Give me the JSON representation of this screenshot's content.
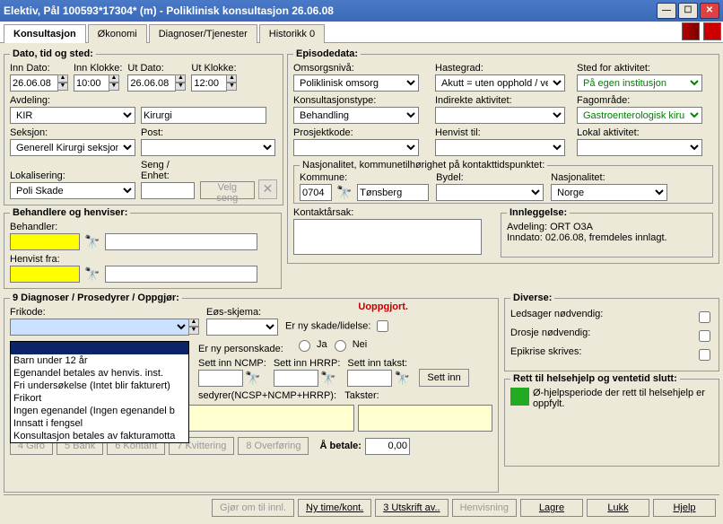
{
  "window": {
    "title": "Elektiv, Pål 100593*17304* (m) - Poliklinisk konsultasjon 26.06.08"
  },
  "tabs": [
    "Konsultasjon",
    "Økonomi",
    "Diagnoser/Tjenester",
    "Historikk 0"
  ],
  "dts": {
    "legend": "Dato, tid og sted:",
    "inn_dato_lbl": "Inn Dato:",
    "inn_dato": "26.06.08",
    "inn_klokke_lbl": "Inn Klokke:",
    "inn_klokke": "10:00",
    "ut_dato_lbl": "Ut Dato:",
    "ut_dato": "26.06.08",
    "ut_klokke_lbl": "Ut Klokke:",
    "ut_klokke": "12:00",
    "avdeling_lbl": "Avdeling:",
    "avdeling": "KIR",
    "avdeling_desc": "Kirurgi",
    "seksjon_lbl": "Seksjon:",
    "seksjon": "Generell Kirurgi seksjon",
    "post_lbl": "Post:",
    "post": "",
    "lokalisering_lbl": "Lokalisering:",
    "lokalisering": "Poli Skade",
    "seng_lbl": "Seng / Enhet:",
    "seng": "",
    "velg_seng": "Velg seng"
  },
  "beh": {
    "legend": "Behandlere og henviser:",
    "behandler_lbl": "Behandler:",
    "behandler": "",
    "henvist_fra_lbl": "Henvist fra:",
    "henvist_fra": ""
  },
  "epi": {
    "legend": "Episodedata:",
    "omsorg_lbl": "Omsorgsnivå:",
    "omsorg": "Poliklinisk omsorg",
    "haste_lbl": "Hastegrad:",
    "haste": "Akutt = uten opphold / ve",
    "sted_lbl": "Sted for aktivitet:",
    "sted": "På egen institusjon",
    "kons_lbl": "Konsultasjonstype:",
    "kons": "Behandling",
    "ind_lbl": "Indirekte aktivitet:",
    "ind": "",
    "fag_lbl": "Fagområde:",
    "fag": "Gastroenterologisk kirurgi",
    "pros_lbl": "Prosjektkode:",
    "pros": "",
    "henv_lbl": "Henvist til:",
    "henv": "",
    "lokal_lbl": "Lokal aktivitet:",
    "lokal": "",
    "natlegend": "Nasjonalitet, kommunetilhørighet på kontakttidspunktet:",
    "komm_lbl": "Kommune:",
    "komm_kode": "0704",
    "komm_navn": "Tønsberg",
    "bydel_lbl": "Bydel:",
    "bydel": "",
    "nasj_lbl": "Nasjonalitet:",
    "nasj": "Norge",
    "kont_lbl": "Kontaktårsak:",
    "kont": ""
  },
  "innl": {
    "legend": "Innleggelse:",
    "line1": "Avdeling: ORT O3A",
    "line2": "Inndato: 02.06.08, fremdeles innlagt."
  },
  "diag": {
    "legend": "9 Diagnoser / Prosedyrer / Oppgjør:",
    "status": "Uoppgjort.",
    "frikode_lbl": "Frikode:",
    "frikode": "",
    "eos_lbl": "Eøs-skjema:",
    "eos": "",
    "ny_skade_lbl": "Er ny skade/lidelse:",
    "ny_person_lbl": "Er ny personskade:",
    "ja": "Ja",
    "nei": "Nei",
    "ncmp_lbl": "Sett inn NCMP:",
    "hrrp_lbl": "Sett inn HRRP:",
    "takst_lbl": "Sett inn takst:",
    "sett_inn": "Sett inn",
    "sedyrer_lbl": "sedyrer(NCSP+NCMP+HRRP):",
    "takster_lbl": "Takster:",
    "btns": [
      "4 Giro",
      "5 Bank",
      "6 Kontant",
      "7 Kvittering",
      "8 Overføring"
    ],
    "betale_lbl": "Å betale:",
    "betale": "0,00",
    "dropdown": [
      "Barn under 12 år",
      "Egenandel betales av henvis. inst.",
      "Fri undersøkelse (Intet blir fakturert)",
      "Frikort",
      "Ingen egenandel (Ingen egenandel b",
      "Innsatt i fengsel",
      "Konsultasjon betales av fakturamotta"
    ]
  },
  "div": {
    "legend": "Diverse:",
    "ledsager": "Ledsager nødvendig:",
    "drosje": "Drosje nødvendig:",
    "epikrise": "Epikrise skrives:"
  },
  "rett": {
    "legend": "Rett til helsehjelp og ventetid slutt:",
    "text": "Ø-hjelpsperiode der rett til helsehjelp er oppfylt."
  },
  "footer": {
    "gjor": "Gjør om til innl.",
    "ny": "Ny time/kont.",
    "utskrift": "3 Utskrift av..",
    "henvisning": "Henvisning",
    "lagre": "Lagre",
    "lukk": "Lukk",
    "hjelp": "Hjelp"
  }
}
